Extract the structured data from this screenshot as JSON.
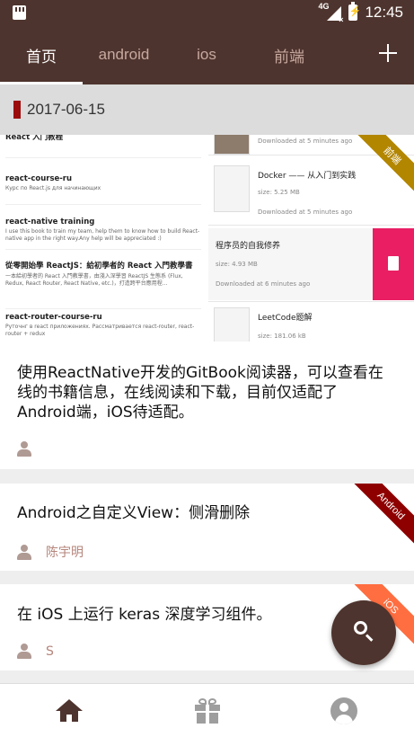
{
  "status_bar": {
    "network": "4G",
    "time": "12:45"
  },
  "tabs": [
    {
      "label": "首页",
      "active": true
    },
    {
      "label": "android",
      "active": false
    },
    {
      "label": "ios",
      "active": false
    },
    {
      "label": "前端",
      "active": false
    }
  ],
  "date_header": "2017-06-15",
  "embedded_screenshot": {
    "left": [
      {
        "title": "React 入门教程",
        "desc": ""
      },
      {
        "title": "react-course-ru",
        "desc": "Курс по React.js для начинающих"
      },
      {
        "title": "react-native training",
        "desc": "I use this book to train my team, help them to know how to build React-native app in the right way.Any help will be appreciated :)"
      },
      {
        "title": "從零開始學 ReactJS：給初學者的 React 入門教學書",
        "desc": "一本給初學者的 React 入門教學書，由淺入深學習 ReactJS 生態系 (Flux, Redux, React Router, React Native, etc.)，打造跨平台應用程..."
      },
      {
        "title": "react-router-course-ru",
        "desc": "Руточнг в react приложениях. Рассматривается react-router, react-router + redux"
      }
    ],
    "right": [
      {
        "title": "",
        "size": "",
        "downloaded": "Downloaded at 5 minutes ago"
      },
      {
        "title": "Docker —— 从入门到实践",
        "size": "size: 5.25 MB",
        "downloaded": "Downloaded at 5 minutes ago"
      },
      {
        "title": "程序员的自我修养",
        "size": "size: 4.93 MB",
        "downloaded": "Downloaded at 6 minutes ago"
      },
      {
        "title": "LeetCode题解",
        "size": "size: 181.06 kB",
        "downloaded": ""
      }
    ],
    "ribbon": "前端"
  },
  "articles": [
    {
      "title": "使用ReactNative开发的GitBook阅读器，可以查看在线的书籍信息，在线阅读和下载，目前仅适配了Android端，iOS待适配。",
      "author": ""
    },
    {
      "title": "Android之自定义View：侧滑删除",
      "author": "陈宇明",
      "ribbon": "Android",
      "ribbon_color": "#8e0000"
    },
    {
      "title": "在 iOS 上运行 keras 深度学习组件。",
      "author": "S",
      "ribbon": "iOS",
      "ribbon_color": "#ff6e40"
    }
  ],
  "colors": {
    "primary": "#4e342e",
    "date_mark": "#9b0d0d",
    "delete": "#e91e63",
    "front_ribbon": "#b38600"
  },
  "icons": {
    "fab": "search-icon",
    "nav": [
      "home-icon",
      "gift-icon",
      "account-icon"
    ]
  }
}
